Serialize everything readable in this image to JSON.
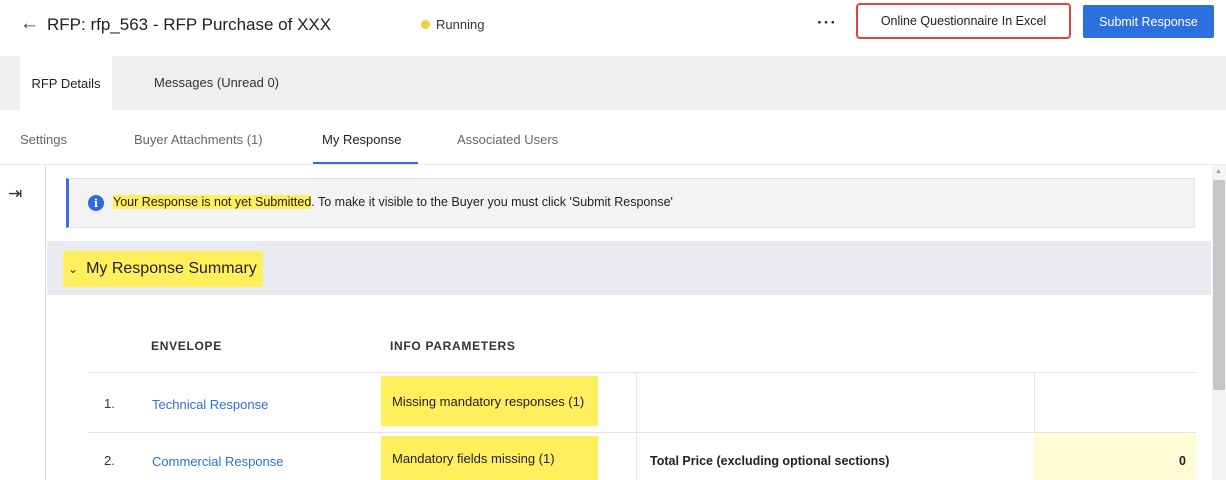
{
  "header": {
    "title": "RFP: rfp_563 - RFP Purchase of XXX",
    "status": "Running",
    "status_color": "#f5cd33",
    "more_label": "···",
    "excel_button": "Online Questionnaire In Excel",
    "submit_button": "Submit Response",
    "accent_color": "#2c6fde",
    "highlight_color": "#ffef5c",
    "annotation_color": "#e0443b"
  },
  "tabs": [
    {
      "label": "RFP Details",
      "active": true
    },
    {
      "label": "Messages (Unread 0)",
      "active": false
    }
  ],
  "subtabs": [
    {
      "label": "Settings",
      "active": false
    },
    {
      "label": "Buyer Attachments (1)",
      "active": false
    },
    {
      "label": "My Response",
      "active": true
    },
    {
      "label": "Associated Users",
      "active": false
    }
  ],
  "banner": {
    "highlighted": "Your Response is not yet Submitted",
    "rest": ". To make it visible to the Buyer you must click 'Submit Response'"
  },
  "summary": {
    "title": "My Response Summary",
    "columns": [
      "ENVELOPE",
      "INFO PARAMETERS"
    ],
    "rows": [
      {
        "num": "1.",
        "envelope": "Technical Response",
        "info": "Missing mandatory responses (1)",
        "label": "",
        "value": ""
      },
      {
        "num": "2.",
        "envelope": "Commercial Response",
        "info": "Mandatory fields missing (1)",
        "label": "Total Price (excluding optional sections)",
        "value": "0"
      }
    ]
  }
}
